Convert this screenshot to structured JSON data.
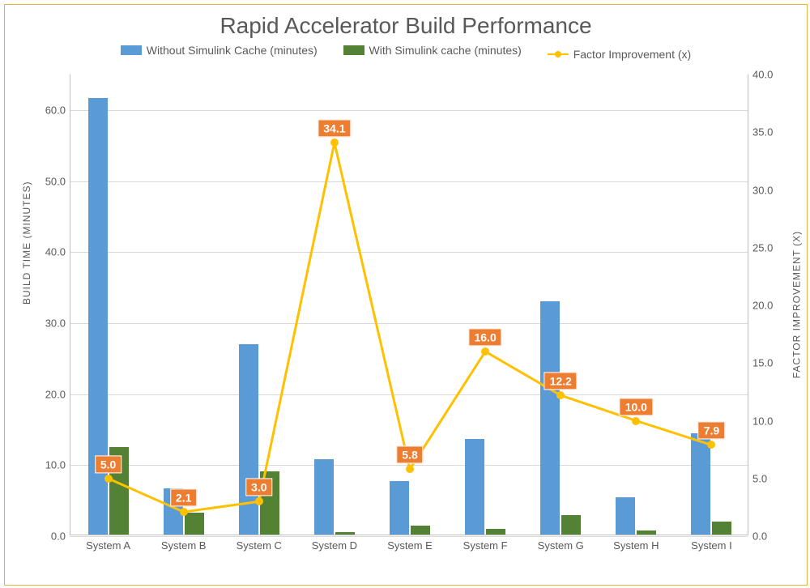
{
  "title": "Rapid Accelerator Build Performance",
  "legend": {
    "without": "Without Simulink Cache (minutes)",
    "with": "With Simulink cache (minutes)",
    "factor": "Factor Improvement (x)"
  },
  "axes": {
    "ylabel_left": "BUILD TIME (MINUTES)",
    "ylabel_right": "FACTOR IMPROVEMENT (X)"
  },
  "colors": {
    "without": "#5b9bd5",
    "with": "#548235",
    "factor_line": "#ffc000",
    "factor_label_bg": "#ed7d31",
    "factor_label_text": "#ffffff",
    "grid": "#d9d9d9",
    "frame": "#e6b33d"
  },
  "chart_data": {
    "type": "bar+line",
    "categories": [
      "System A",
      "System B",
      "System C",
      "System D",
      "System E",
      "System F",
      "System G",
      "System H",
      "System I"
    ],
    "series": [
      {
        "name": "Without Simulink Cache (minutes)",
        "axis": "left",
        "kind": "bar",
        "color": "#5b9bd5",
        "values": [
          61.5,
          6.5,
          26.8,
          10.6,
          7.5,
          13.5,
          32.8,
          5.2,
          14.2
        ]
      },
      {
        "name": "With Simulink cache (minutes)",
        "axis": "left",
        "kind": "bar",
        "color": "#548235",
        "values": [
          12.3,
          3.1,
          8.9,
          0.31,
          1.3,
          0.84,
          2.7,
          0.52,
          1.8
        ]
      },
      {
        "name": "Factor Improvement (x)",
        "axis": "right",
        "kind": "line",
        "color": "#ffc000",
        "values": [
          5.0,
          2.1,
          3.0,
          34.1,
          5.8,
          16.0,
          12.2,
          10.0,
          7.9
        ],
        "data_labels": [
          "5.0",
          "2.1",
          "3.0",
          "34.1",
          "5.8",
          "16.0",
          "12.2",
          "10.0",
          "7.9"
        ]
      }
    ],
    "y_left": {
      "min": 0.0,
      "max": 65.0,
      "ticks": [
        0.0,
        10.0,
        20.0,
        30.0,
        40.0,
        50.0,
        60.0
      ]
    },
    "y_right": {
      "min": 0.0,
      "max": 40.0,
      "ticks": [
        0.0,
        5.0,
        10.0,
        15.0,
        20.0,
        25.0,
        30.0,
        35.0,
        40.0
      ]
    }
  }
}
